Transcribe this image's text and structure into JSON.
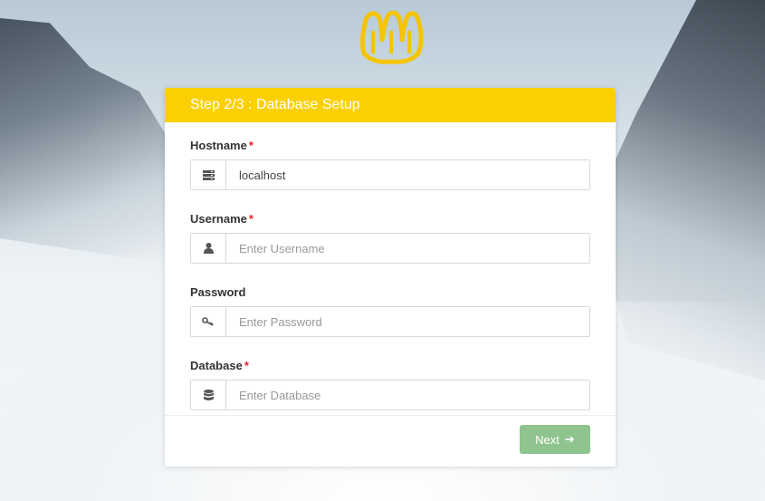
{
  "wizard": {
    "title": "Step 2/3 : Database Setup"
  },
  "fields": {
    "hostname": {
      "label": "Hostname",
      "required": "*",
      "value": "localhost",
      "placeholder": ""
    },
    "username": {
      "label": "Username",
      "required": "*",
      "value": "",
      "placeholder": "Enter Username"
    },
    "password": {
      "label": "Password",
      "value": "",
      "placeholder": "Enter Password"
    },
    "database": {
      "label": "Database",
      "required": "*",
      "value": "",
      "placeholder": "Enter Database"
    }
  },
  "icons": {
    "hostname": "server-icon",
    "username": "user-icon",
    "password": "key-icon",
    "database": "database-icon",
    "next": "arrow-right-icon"
  },
  "actions": {
    "next_label": "Next",
    "next_arrow": "➔"
  },
  "colors": {
    "header": "#fcd000",
    "next_button": "#8fc48f",
    "required": "#e23"
  }
}
